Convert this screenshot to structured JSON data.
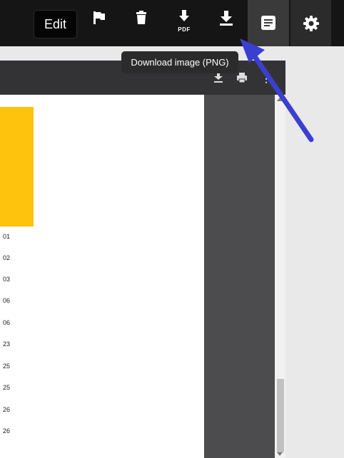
{
  "toolbar": {
    "edit_label": "Edit",
    "pdf_label": "PDF",
    "buttons": [
      "flag-icon",
      "trash-icon",
      "download-pdf-icon",
      "download-icon",
      "notes-icon",
      "gear-icon"
    ]
  },
  "tooltip": {
    "text": "Download image (PNG)"
  },
  "viewer": {
    "header_icons": [
      "download-icon",
      "print-icon",
      "more-vert-icon"
    ],
    "accent_color": "#fdc30d",
    "numbers": [
      "01",
      "02",
      "03",
      "06",
      "06",
      "23",
      "25",
      "25",
      "26",
      "26"
    ]
  },
  "annotation": {
    "arrow_color": "#3b3fd0"
  }
}
